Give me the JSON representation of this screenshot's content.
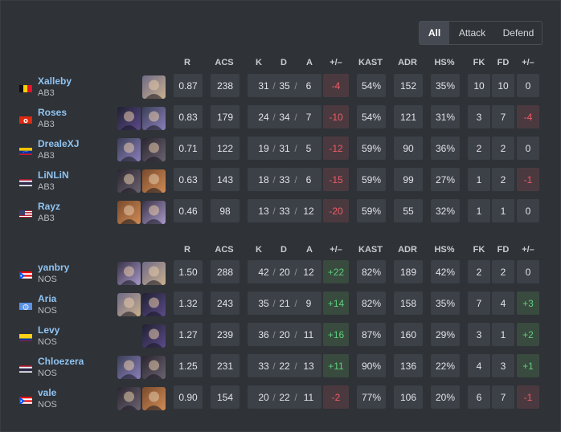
{
  "filters": [
    "All",
    "Attack",
    "Defend"
  ],
  "active_filter": "All",
  "columns": [
    "R",
    "ACS",
    "K",
    "D",
    "A",
    "+/–",
    "KAST",
    "ADR",
    "HS%",
    "FK",
    "FD",
    "+/–"
  ],
  "kda_sep": "/",
  "teams": [
    {
      "players": [
        {
          "name": "Xalleby",
          "team": "AB3",
          "flag": "belgium",
          "agents": [
            "agent-icon"
          ],
          "r": "0.87",
          "acs": "238",
          "k": "31",
          "d": "35",
          "a": "6",
          "pm": "-4",
          "kast": "54%",
          "adr": "152",
          "hs": "35%",
          "fk": "10",
          "fd": "10",
          "fpm": "0"
        },
        {
          "name": "Roses",
          "team": "AB3",
          "flag": "hongkong",
          "agents": [
            "agent-icon",
            "agent-icon"
          ],
          "r": "0.83",
          "acs": "179",
          "k": "24",
          "d": "34",
          "a": "7",
          "pm": "-10",
          "kast": "54%",
          "adr": "121",
          "hs": "31%",
          "fk": "3",
          "fd": "7",
          "fpm": "-4"
        },
        {
          "name": "DrealeXJ",
          "team": "AB3",
          "flag": "venezuela",
          "agents": [
            "agent-icon",
            "agent-icon"
          ],
          "r": "0.71",
          "acs": "122",
          "k": "19",
          "d": "31",
          "a": "5",
          "pm": "-12",
          "kast": "59%",
          "adr": "90",
          "hs": "36%",
          "fk": "2",
          "fd": "2",
          "fpm": "0"
        },
        {
          "name": "LiNLiN",
          "team": "AB3",
          "flag": "thailand",
          "agents": [
            "agent-icon",
            "agent-icon"
          ],
          "r": "0.63",
          "acs": "143",
          "k": "18",
          "d": "33",
          "a": "6",
          "pm": "-15",
          "kast": "59%",
          "adr": "99",
          "hs": "27%",
          "fk": "1",
          "fd": "2",
          "fpm": "-1"
        },
        {
          "name": "Rayz",
          "team": "AB3",
          "flag": "usa",
          "agents": [
            "agent-icon",
            "agent-icon"
          ],
          "r": "0.46",
          "acs": "98",
          "k": "13",
          "d": "33",
          "a": "12",
          "pm": "-20",
          "kast": "59%",
          "adr": "55",
          "hs": "32%",
          "fk": "1",
          "fd": "1",
          "fpm": "0"
        }
      ]
    },
    {
      "players": [
        {
          "name": "yanbry",
          "team": "NOS",
          "flag": "puertorico",
          "agents": [
            "agent-icon",
            "agent-icon"
          ],
          "r": "1.50",
          "acs": "288",
          "k": "42",
          "d": "20",
          "a": "12",
          "pm": "+22",
          "kast": "82%",
          "adr": "189",
          "hs": "42%",
          "fk": "2",
          "fd": "2",
          "fpm": "0"
        },
        {
          "name": "Aria",
          "team": "NOS",
          "flag": "un",
          "agents": [
            "agent-icon",
            "agent-icon"
          ],
          "r": "1.32",
          "acs": "243",
          "k": "35",
          "d": "21",
          "a": "9",
          "pm": "+14",
          "kast": "82%",
          "adr": "158",
          "hs": "35%",
          "fk": "7",
          "fd": "4",
          "fpm": "+3"
        },
        {
          "name": "Levy",
          "team": "NOS",
          "flag": "colombia",
          "agents": [
            "agent-icon"
          ],
          "r": "1.27",
          "acs": "239",
          "k": "36",
          "d": "20",
          "a": "11",
          "pm": "+16",
          "kast": "87%",
          "adr": "160",
          "hs": "29%",
          "fk": "3",
          "fd": "1",
          "fpm": "+2"
        },
        {
          "name": "Chloezera",
          "team": "NOS",
          "flag": "thailand",
          "agents": [
            "agent-icon",
            "agent-icon"
          ],
          "r": "1.25",
          "acs": "231",
          "k": "33",
          "d": "22",
          "a": "13",
          "pm": "+11",
          "kast": "90%",
          "adr": "136",
          "hs": "22%",
          "fk": "4",
          "fd": "3",
          "fpm": "+1"
        },
        {
          "name": "vale",
          "team": "NOS",
          "flag": "puertorico",
          "agents": [
            "agent-icon",
            "agent-icon"
          ],
          "r": "0.90",
          "acs": "154",
          "k": "20",
          "d": "22",
          "a": "11",
          "pm": "-2",
          "kast": "77%",
          "adr": "106",
          "hs": "20%",
          "fk": "6",
          "fd": "7",
          "fpm": "-1"
        }
      ]
    }
  ]
}
